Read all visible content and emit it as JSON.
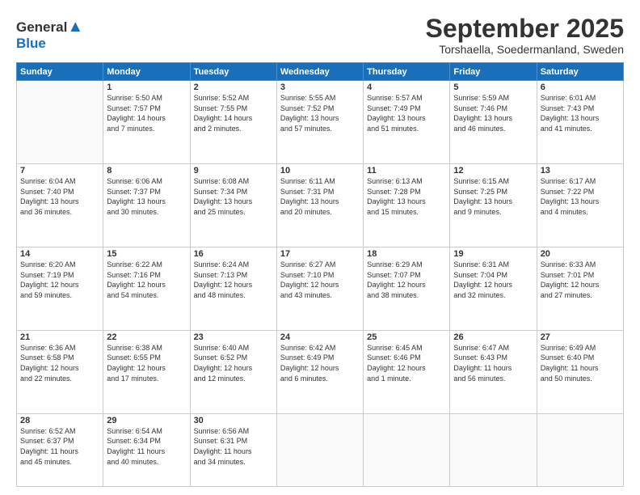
{
  "logo": {
    "general": "General",
    "blue": "Blue"
  },
  "header": {
    "month": "September 2025",
    "location": "Torshaella, Soedermanland, Sweden"
  },
  "weekdays": [
    "Sunday",
    "Monday",
    "Tuesday",
    "Wednesday",
    "Thursday",
    "Friday",
    "Saturday"
  ],
  "weeks": [
    [
      {
        "day": "",
        "info": ""
      },
      {
        "day": "1",
        "info": "Sunrise: 5:50 AM\nSunset: 7:57 PM\nDaylight: 14 hours\nand 7 minutes."
      },
      {
        "day": "2",
        "info": "Sunrise: 5:52 AM\nSunset: 7:55 PM\nDaylight: 14 hours\nand 2 minutes."
      },
      {
        "day": "3",
        "info": "Sunrise: 5:55 AM\nSunset: 7:52 PM\nDaylight: 13 hours\nand 57 minutes."
      },
      {
        "day": "4",
        "info": "Sunrise: 5:57 AM\nSunset: 7:49 PM\nDaylight: 13 hours\nand 51 minutes."
      },
      {
        "day": "5",
        "info": "Sunrise: 5:59 AM\nSunset: 7:46 PM\nDaylight: 13 hours\nand 46 minutes."
      },
      {
        "day": "6",
        "info": "Sunrise: 6:01 AM\nSunset: 7:43 PM\nDaylight: 13 hours\nand 41 minutes."
      }
    ],
    [
      {
        "day": "7",
        "info": "Sunrise: 6:04 AM\nSunset: 7:40 PM\nDaylight: 13 hours\nand 36 minutes."
      },
      {
        "day": "8",
        "info": "Sunrise: 6:06 AM\nSunset: 7:37 PM\nDaylight: 13 hours\nand 30 minutes."
      },
      {
        "day": "9",
        "info": "Sunrise: 6:08 AM\nSunset: 7:34 PM\nDaylight: 13 hours\nand 25 minutes."
      },
      {
        "day": "10",
        "info": "Sunrise: 6:11 AM\nSunset: 7:31 PM\nDaylight: 13 hours\nand 20 minutes."
      },
      {
        "day": "11",
        "info": "Sunrise: 6:13 AM\nSunset: 7:28 PM\nDaylight: 13 hours\nand 15 minutes."
      },
      {
        "day": "12",
        "info": "Sunrise: 6:15 AM\nSunset: 7:25 PM\nDaylight: 13 hours\nand 9 minutes."
      },
      {
        "day": "13",
        "info": "Sunrise: 6:17 AM\nSunset: 7:22 PM\nDaylight: 13 hours\nand 4 minutes."
      }
    ],
    [
      {
        "day": "14",
        "info": "Sunrise: 6:20 AM\nSunset: 7:19 PM\nDaylight: 12 hours\nand 59 minutes."
      },
      {
        "day": "15",
        "info": "Sunrise: 6:22 AM\nSunset: 7:16 PM\nDaylight: 12 hours\nand 54 minutes."
      },
      {
        "day": "16",
        "info": "Sunrise: 6:24 AM\nSunset: 7:13 PM\nDaylight: 12 hours\nand 48 minutes."
      },
      {
        "day": "17",
        "info": "Sunrise: 6:27 AM\nSunset: 7:10 PM\nDaylight: 12 hours\nand 43 minutes."
      },
      {
        "day": "18",
        "info": "Sunrise: 6:29 AM\nSunset: 7:07 PM\nDaylight: 12 hours\nand 38 minutes."
      },
      {
        "day": "19",
        "info": "Sunrise: 6:31 AM\nSunset: 7:04 PM\nDaylight: 12 hours\nand 32 minutes."
      },
      {
        "day": "20",
        "info": "Sunrise: 6:33 AM\nSunset: 7:01 PM\nDaylight: 12 hours\nand 27 minutes."
      }
    ],
    [
      {
        "day": "21",
        "info": "Sunrise: 6:36 AM\nSunset: 6:58 PM\nDaylight: 12 hours\nand 22 minutes."
      },
      {
        "day": "22",
        "info": "Sunrise: 6:38 AM\nSunset: 6:55 PM\nDaylight: 12 hours\nand 17 minutes."
      },
      {
        "day": "23",
        "info": "Sunrise: 6:40 AM\nSunset: 6:52 PM\nDaylight: 12 hours\nand 12 minutes."
      },
      {
        "day": "24",
        "info": "Sunrise: 6:42 AM\nSunset: 6:49 PM\nDaylight: 12 hours\nand 6 minutes."
      },
      {
        "day": "25",
        "info": "Sunrise: 6:45 AM\nSunset: 6:46 PM\nDaylight: 12 hours\nand 1 minute."
      },
      {
        "day": "26",
        "info": "Sunrise: 6:47 AM\nSunset: 6:43 PM\nDaylight: 11 hours\nand 56 minutes."
      },
      {
        "day": "27",
        "info": "Sunrise: 6:49 AM\nSunset: 6:40 PM\nDaylight: 11 hours\nand 50 minutes."
      }
    ],
    [
      {
        "day": "28",
        "info": "Sunrise: 6:52 AM\nSunset: 6:37 PM\nDaylight: 11 hours\nand 45 minutes."
      },
      {
        "day": "29",
        "info": "Sunrise: 6:54 AM\nSunset: 6:34 PM\nDaylight: 11 hours\nand 40 minutes."
      },
      {
        "day": "30",
        "info": "Sunrise: 6:56 AM\nSunset: 6:31 PM\nDaylight: 11 hours\nand 34 minutes."
      },
      {
        "day": "",
        "info": ""
      },
      {
        "day": "",
        "info": ""
      },
      {
        "day": "",
        "info": ""
      },
      {
        "day": "",
        "info": ""
      }
    ]
  ]
}
